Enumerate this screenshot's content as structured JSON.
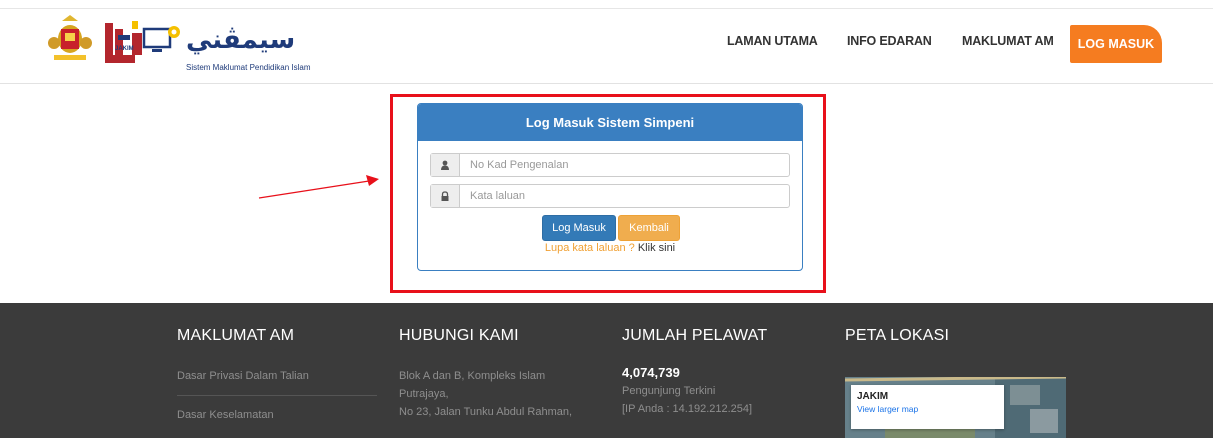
{
  "header": {
    "logo_text": "سيمڤني",
    "logo_subtitle": "Sistem Maklumat Pendidikan Islam",
    "jakim_label": "JAKIM",
    "nav": [
      "LAMAN UTAMA",
      "INFO EDARAN",
      "MAKLUMAT AM"
    ],
    "login_button": "LOG MASUK",
    "accent_color": "#f57c20"
  },
  "login": {
    "title": "Log Masuk Sistem Simpeni",
    "ic_placeholder": "No Kad Pengenalan",
    "password_placeholder": "Kata laluan",
    "submit_label": "Log Masuk",
    "back_label": "Kembali",
    "forgot_text": "Lupa kata laluan ?",
    "forgot_link": "Klik sini"
  },
  "footer": {
    "maklumat": {
      "heading": "MAKLUMAT AM",
      "links": [
        "Dasar Privasi Dalam Talian",
        "Dasar Keselamatan"
      ]
    },
    "hubungi": {
      "heading": "HUBUNGI KAMI",
      "lines": [
        "Blok A dan B, Kompleks Islam",
        "Putrajaya,",
        "No 23, Jalan Tunku Abdul Rahman,"
      ]
    },
    "pelawat": {
      "heading": "JUMLAH PELAWAT",
      "count": "4,074,739",
      "recent": "Pengunjung Terkini",
      "ip": "[IP Anda : 14.192.212.254]"
    },
    "peta": {
      "heading": "PETA LOKASI",
      "map_title": "JAKIM",
      "map_link": "View larger map"
    }
  }
}
